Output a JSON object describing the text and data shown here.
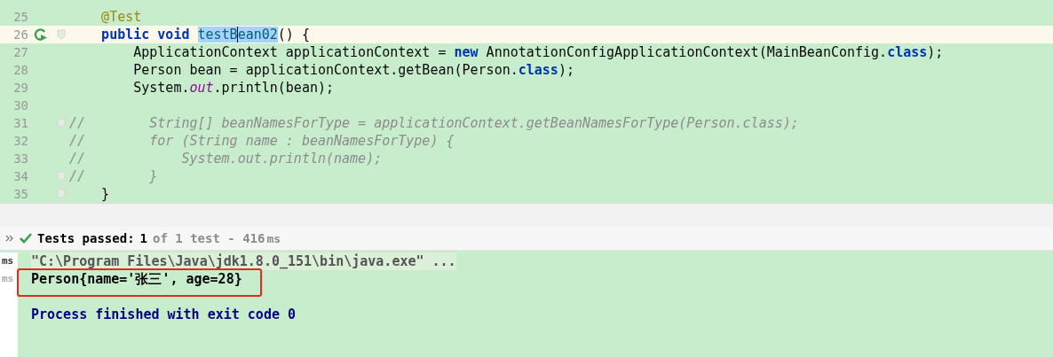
{
  "editor": {
    "lines": [
      {
        "number": "25",
        "tokens": [
          {
            "text": "    @Test",
            "kind": "annotation"
          }
        ]
      },
      {
        "number": "26",
        "current": true,
        "run_icon": true,
        "fold": true,
        "tokens": [
          {
            "text": "    public void ",
            "kind": "keyword"
          },
          {
            "text": "testB",
            "kind": "selection",
            "caret": true
          },
          {
            "text": "ean02",
            "kind": "selection"
          },
          {
            "text": "() {"
          }
        ]
      },
      {
        "number": "27",
        "tokens": [
          {
            "text": "        ApplicationContext applicationContext = "
          },
          {
            "text": "new",
            "kind": "keyword"
          },
          {
            "text": " AnnotationConfigApplicationContext(MainBeanConfig."
          },
          {
            "text": "class",
            "kind": "keyword"
          },
          {
            "text": ");"
          }
        ]
      },
      {
        "number": "28",
        "tokens": [
          {
            "text": "        Person bean = applicationContext.getBean(Person."
          },
          {
            "text": "class",
            "kind": "keyword"
          },
          {
            "text": ");"
          }
        ]
      },
      {
        "number": "29",
        "tokens": [
          {
            "text": "        System."
          },
          {
            "text": "out",
            "kind": "field"
          },
          {
            "text": ".println(bean);"
          }
        ]
      },
      {
        "number": "30"
      },
      {
        "number": "31",
        "fold": true,
        "tokens": [
          {
            "text": "//        String[] beanNamesForType = applicationContext.getBeanNamesForType(Person.class);",
            "kind": "comment"
          }
        ]
      },
      {
        "number": "32",
        "tokens": [
          {
            "text": "//        for (String name : beanNamesForType) {",
            "kind": "comment"
          }
        ]
      },
      {
        "number": "33",
        "tokens": [
          {
            "text": "//            System.out.println(name);",
            "kind": "comment"
          }
        ]
      },
      {
        "number": "34",
        "fold": true,
        "tokens": [
          {
            "text": "//        }",
            "kind": "comment"
          }
        ]
      },
      {
        "number": "35",
        "fold": true,
        "tokens": [
          {
            "text": "    }"
          }
        ]
      }
    ]
  },
  "test_status": {
    "label": "Tests passed:",
    "count": "1",
    "detail": "of 1 test - 416",
    "unit": "ms"
  },
  "console": {
    "lines": [
      {
        "gutter": {
          "text": "ms",
          "selected": true
        },
        "text": "\"C:\\Program Files\\Java\\jdk1.8.0_151\\bin\\java.exe\" ...",
        "kind": "command"
      },
      {
        "gutter": {
          "text": "ms",
          "selected": false
        },
        "text": "Person{name='张三', age=28}",
        "kind": "output",
        "highlighted": true
      },
      {
        "kind": "blank"
      },
      {
        "text": "Process finished with exit code 0",
        "kind": "exit"
      }
    ]
  }
}
